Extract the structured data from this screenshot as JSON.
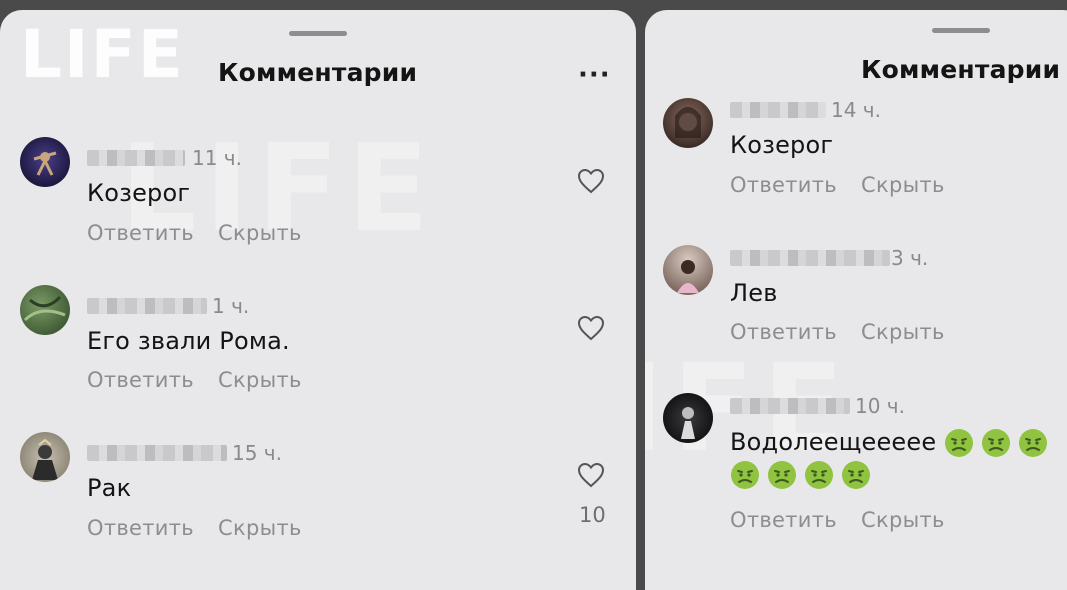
{
  "watermark": "LIFE",
  "left_panel": {
    "title": "Комментарии",
    "more_glyph": "···",
    "comments": [
      {
        "time": "11 ч.",
        "text": "Козерог",
        "reply": "Ответить",
        "hide": "Скрыть"
      },
      {
        "time": "1 ч.",
        "text": "Его звали Рома.",
        "reply": "Ответить",
        "hide": "Скрыть"
      },
      {
        "time": "15 ч.",
        "text": "Рак",
        "reply": "Ответить",
        "hide": "Скрыть",
        "likes": "10"
      }
    ]
  },
  "right_panel": {
    "title": "Комментарии",
    "comments": [
      {
        "time": "14 ч.",
        "text": "Козерог",
        "reply": "Ответить",
        "hide": "Скрыть"
      },
      {
        "time": "3 ч.",
        "text": "Лев",
        "reply": "Ответить",
        "hide": "Скрыть"
      },
      {
        "time": "10 ч.",
        "text": "Водолеещеееее",
        "reply": "Ответить",
        "hide": "Скрыть",
        "emoji": "nauseated-face-icon"
      }
    ]
  },
  "colors": {
    "panel_bg": "#e8e8ea",
    "action_text": "#8d8d91",
    "time_text": "#8a8a8e",
    "emoji_green": "#8fc340"
  }
}
